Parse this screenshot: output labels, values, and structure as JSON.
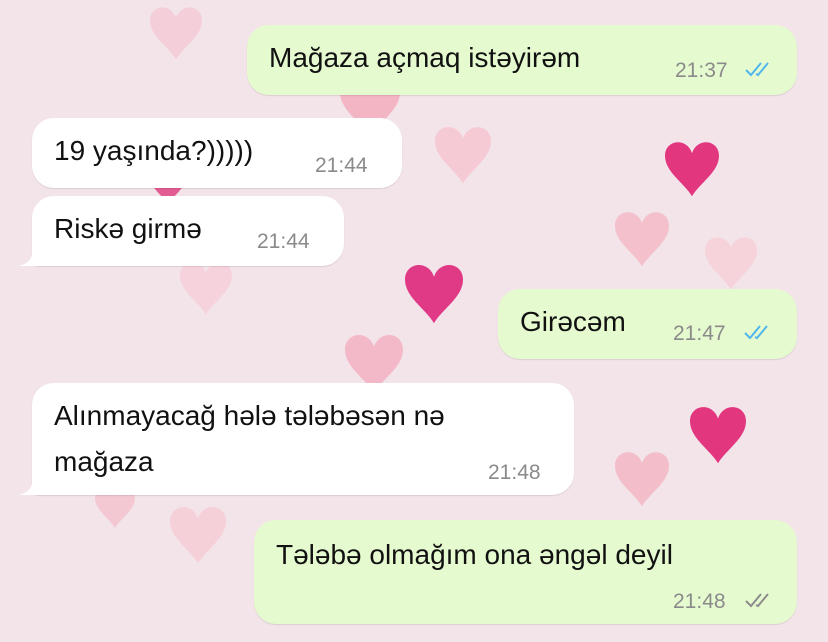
{
  "colors": {
    "incoming_bubble": "#ffffff",
    "outgoing_bubble": "#e6fad0",
    "wallpaper": "#f3e4ea",
    "read_ticks": "#4fb6ec",
    "delivered_ticks": "#8c8c8c"
  },
  "messages": [
    {
      "direction": "out",
      "text": "Mağaza açmaq istəyirəm",
      "time": "21:37",
      "status": "read-double-check-icon"
    },
    {
      "direction": "in",
      "text": "19 yaşında?)))))",
      "time": "21:44"
    },
    {
      "direction": "in",
      "text": "Riskə girmə",
      "time": "21:44"
    },
    {
      "direction": "out",
      "text": "Girəcəm",
      "time": "21:47",
      "status": "read-double-check-icon"
    },
    {
      "direction": "in",
      "text_line1": "Alınmayacağ hələ tələbəsən nə",
      "text_line2": "mağaza",
      "time": "21:48"
    },
    {
      "direction": "out",
      "text": "Tələbə olmağım ona əngəl deyil",
      "time": "21:48",
      "status": "delivered-double-check-icon"
    }
  ]
}
